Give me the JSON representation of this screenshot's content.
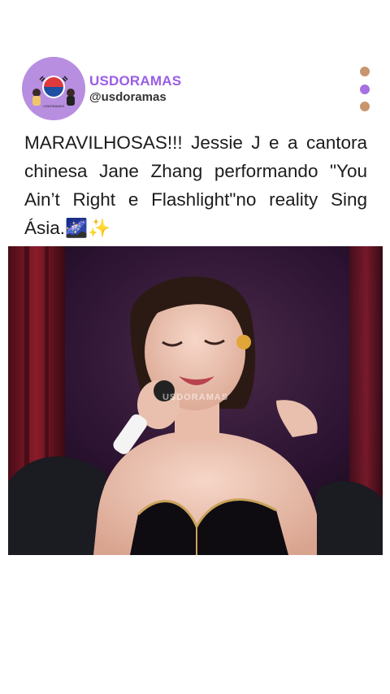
{
  "header": {
    "avatar_label": "USDORAMAS",
    "brand_name": "USDORAMAS",
    "handle": "@usdoramas"
  },
  "menu": {
    "icon": "vertical-dots-icon",
    "colors": [
      "#c9956f",
      "#a671e0",
      "#c9956f"
    ]
  },
  "caption": {
    "text": "MARAVILHOSAS!!! Jessie J e a cantora chinesa Jane Zhang performando \"You Ain’t Right e Flashlight\"no reality Sing Ásia.🌌✨"
  },
  "media": {
    "watermark": "USDORAMAS"
  },
  "colors": {
    "brand": "#9b5de5",
    "background": "#ffffff"
  }
}
